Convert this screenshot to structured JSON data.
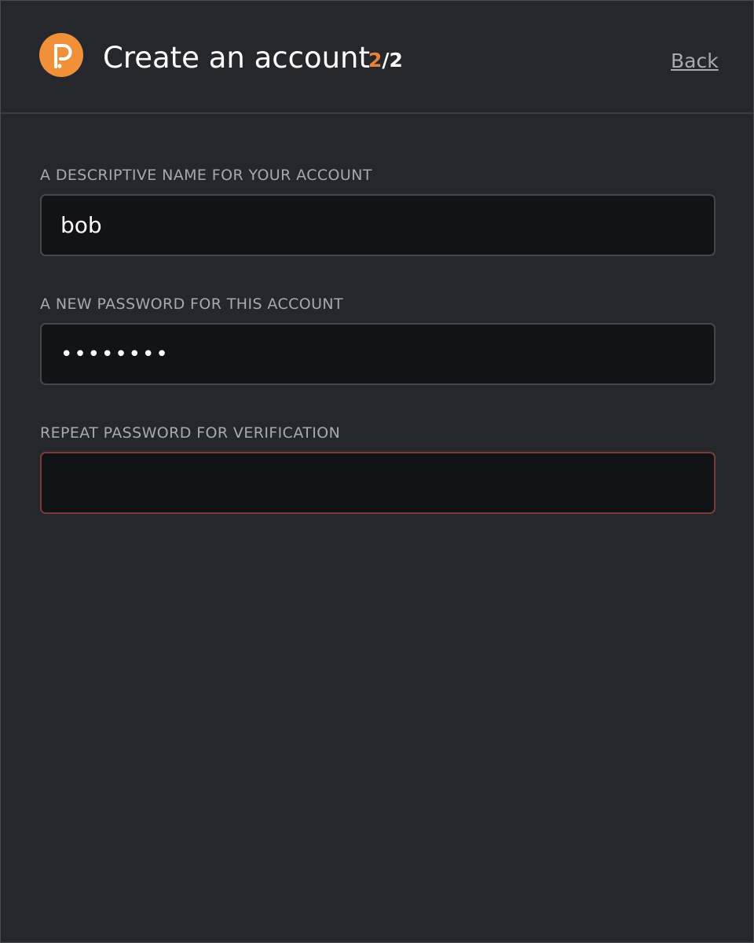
{
  "header": {
    "title": "Create an account",
    "step_current": "2",
    "step_total": "/2",
    "back_label": "Back",
    "logo_icon": "polkadot-logo-icon",
    "accent_color": "#e6833a"
  },
  "form": {
    "name_label": "A DESCRIPTIVE NAME FOR YOUR ACCOUNT",
    "name_value": "bob",
    "password_label": "A NEW PASSWORD FOR THIS ACCOUNT",
    "password_value": "********",
    "repeat_label": "REPEAT PASSWORD FOR VERIFICATION",
    "repeat_value": "",
    "error_border_color": "#7c3a37"
  }
}
